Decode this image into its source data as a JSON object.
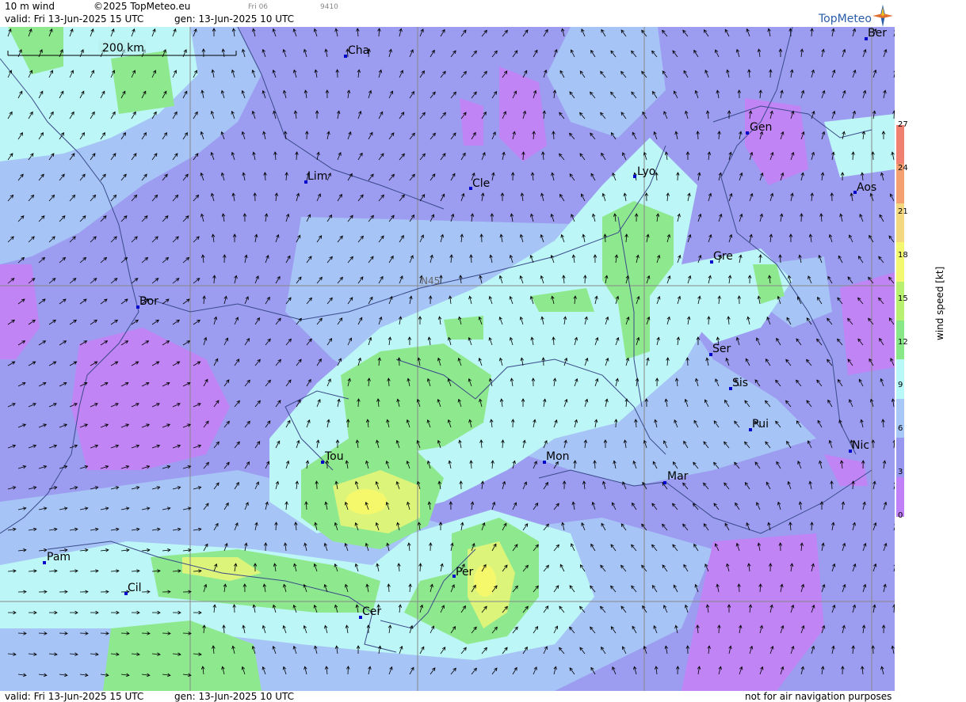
{
  "header": {
    "product": "10 m wind",
    "copyright": "©2025 TopMeteo.eu",
    "day_code": "Fri 06",
    "run_code": "9410",
    "valid": "valid:  Fri  13-Jun-2025  15 UTC",
    "generated": "gen: 13-Jun-2025 10 UTC",
    "logo": "TopMeteo"
  },
  "footer": {
    "valid": "valid:  Fri  13-Jun-2025  15 UTC",
    "generated": "gen: 13-Jun-2025 10 UTC",
    "disclaimer": "not for air navigation purposes"
  },
  "map": {
    "scale_label": "200 km",
    "latitude_label": "N45",
    "cities": [
      "Ber",
      "Cha",
      "Gen",
      "Lim",
      "Cle",
      "Lyo",
      "Aos",
      "Gre",
      "Bor",
      "Ser",
      "Sis",
      "Pui",
      "Nic",
      "Tou",
      "Mon",
      "Mar",
      "Pam",
      "Per",
      "Cil",
      "Cer"
    ]
  },
  "legend": {
    "quantity": "wind speed [kt]",
    "ticks": [
      "27",
      "24",
      "21",
      "18",
      "15",
      "12",
      "9",
      "6",
      "3",
      "0"
    ],
    "colors": [
      "#f08070",
      "#f4a070",
      "#f4d880",
      "#f4f870",
      "#b8f070",
      "#88e888",
      "#b8f8f8",
      "#a8c8f8",
      "#9898f0",
      "#c080f8"
    ]
  }
}
